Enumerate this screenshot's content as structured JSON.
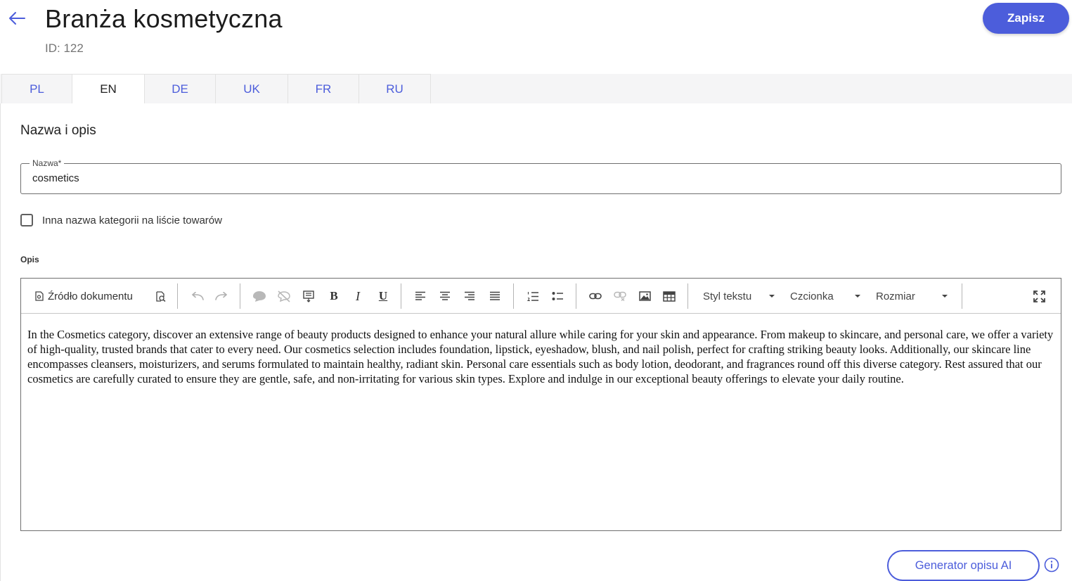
{
  "header": {
    "title": "Branża kosmetyczna",
    "id_text": "ID: 122",
    "save_label": "Zapisz",
    "back_icon": "arrow-left-icon"
  },
  "tabs": [
    {
      "label": "PL",
      "active": false
    },
    {
      "label": "EN",
      "active": true
    },
    {
      "label": "DE",
      "active": false
    },
    {
      "label": "UK",
      "active": false
    },
    {
      "label": "FR",
      "active": false
    },
    {
      "label": "RU",
      "active": false
    }
  ],
  "section": {
    "title": "Nazwa i opis"
  },
  "name_field": {
    "label": "Nazwa*",
    "value": "cosmetics"
  },
  "checkbox": {
    "label": "Inna nazwa kategorii na liście towarów",
    "checked": false
  },
  "description": {
    "label": "Opis",
    "toolbar": {
      "source_label": "Źródło dokumentu",
      "style_label": "Styl tekstu",
      "font_label": "Czcionka",
      "size_label": "Rozmiar",
      "bold": "B",
      "italic": "I",
      "underline": "U"
    },
    "text": "In the Cosmetics category, discover an extensive range of beauty products designed to enhance your natural allure while caring for your skin and appearance. From makeup to skincare, and personal care, we offer a variety of high-quality, trusted brands that cater to every need. Our cosmetics selection includes foundation, lipstick, eyeshadow, blush, and nail polish, perfect for crafting striking beauty looks. Additionally, our skincare line encompasses cleansers, moisturizers, and serums formulated to maintain healthy, radiant skin. Personal care essentials such as body lotion, deodorant, and fragrances round off this diverse category. Rest assured that our cosmetics are carefully curated to ensure they are gentle, safe, and non-irritating for various skin types. Explore and indulge in our exceptional beauty offerings to elevate your daily routine."
  },
  "ai_button": {
    "label": "Generator opisu AI",
    "info_icon": "info-icon"
  },
  "colors": {
    "accent": "#4c5ddb",
    "tab_bg": "#f5f5f6",
    "border": "#6f6f6f"
  }
}
